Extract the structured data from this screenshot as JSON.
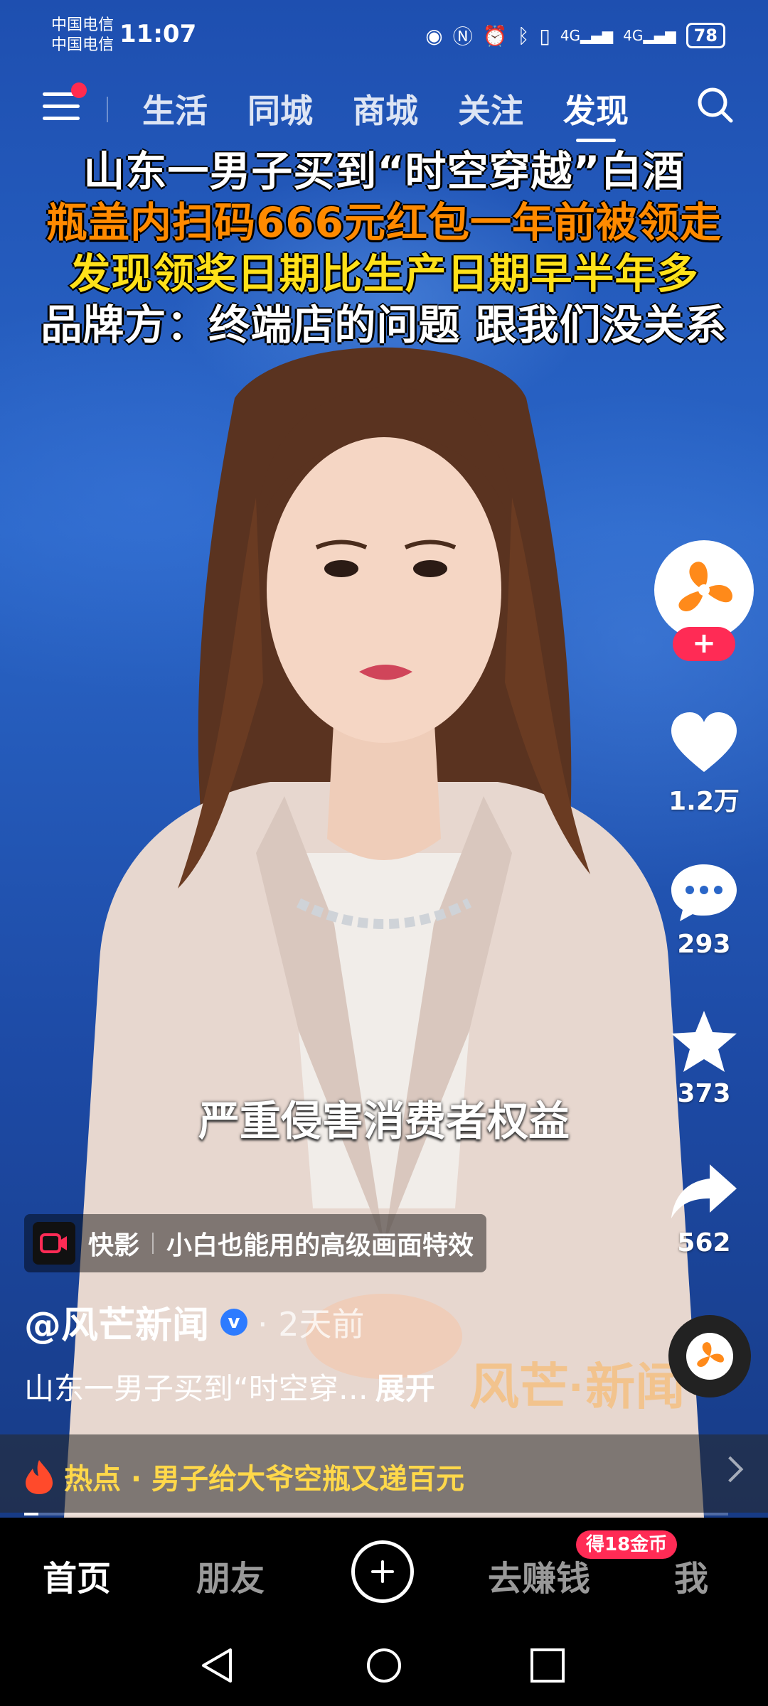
{
  "status_bar": {
    "carrier_1": "中国电信",
    "carrier_2": "中国电信",
    "time": "11:07",
    "signal_1": "4G",
    "signal_2": "4G",
    "battery": "78"
  },
  "top_nav": {
    "tabs": [
      {
        "label": "生活"
      },
      {
        "label": "同城"
      },
      {
        "label": "商城"
      },
      {
        "label": "关注"
      },
      {
        "label": "发现"
      }
    ],
    "active_tab": "发现"
  },
  "video": {
    "headline_lines": [
      "山东一男子买到“时空穿越”白酒",
      "瓶盖内扫码666元红包一年前被领走",
      "发现领奖日期比生产日期早半年多",
      "品牌方：终端店的问题 跟我们没关系"
    ],
    "subtitle": "严重侵害消费者权益"
  },
  "actions": {
    "likes": "1.2万",
    "comments": "293",
    "favorites": "373",
    "shares": "562",
    "follow_symbol": "+"
  },
  "promo": {
    "app_name": "快影",
    "tagline": "小白也能用的高级画面特效"
  },
  "post": {
    "author": "@风芒新闻",
    "verified_mark": "v",
    "time": "· 2天前",
    "caption": "山东一男子买到“时空穿…",
    "expand": "展开"
  },
  "hot_bar": {
    "text": "热点 · 男子给大爷空瓶又递百元"
  },
  "bottom_nav": {
    "home": "首页",
    "friends": "朋友",
    "earn": "去赚钱",
    "earn_badge": "得18金币",
    "me": "我"
  },
  "colors": {
    "accent_red": "#ff2b55",
    "hot_yellow": "#ffd84a",
    "headline_orange": "#ff8a00",
    "headline_yellow": "#ffe11a"
  }
}
